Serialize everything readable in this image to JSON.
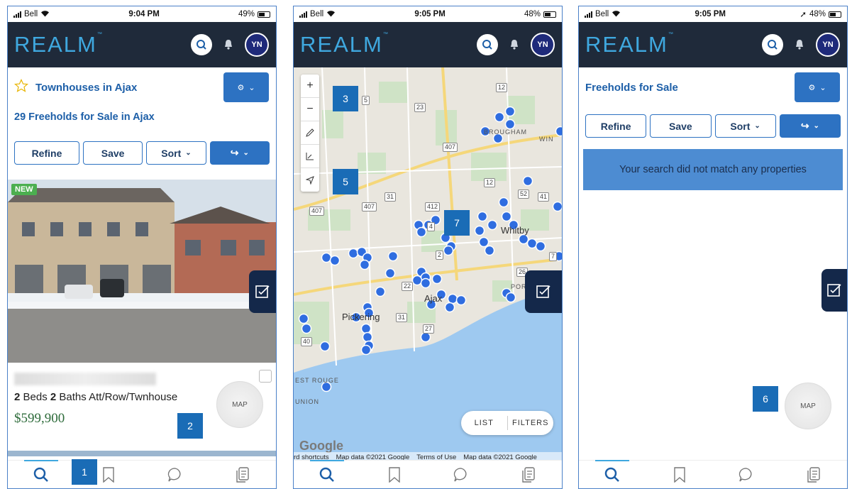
{
  "status": {
    "carrier": "Bell",
    "times": [
      "9:04 PM",
      "9:05 PM",
      "9:05 PM"
    ],
    "battery": [
      "49%",
      "48%",
      "48%"
    ]
  },
  "header": {
    "logo": "REALM",
    "logo_mark": "™",
    "avatar": "YN"
  },
  "screen1": {
    "title": "Townhouses in Ajax",
    "subtitle": "29 Freeholds for Sale in Ajax",
    "buttons": {
      "refine": "Refine",
      "save": "Save",
      "sort": "Sort"
    },
    "listing": {
      "tag": "NEW",
      "beds": "2",
      "beds_label": "Beds",
      "baths": "2",
      "baths_label": "Baths",
      "type": "Att/Row/Twnhouse",
      "price": "$599,900"
    },
    "map_label": "MAP"
  },
  "screen2": {
    "list_label": "LIST",
    "filters_label": "FILTERS",
    "google": "Google",
    "footer": [
      "rd shortcuts",
      "Map data ©2021 Google",
      "Terms of Use",
      "Map data ©2021 Google"
    ],
    "place_labels": [
      "Pickering",
      "Ajax",
      "Whitby",
      "BROUGHAM",
      "PORT",
      "WIN",
      "EST ROUGE",
      "UNION"
    ],
    "road_numbers": [
      "5",
      "23",
      "12",
      "407",
      "407",
      "407",
      "31",
      "412",
      "4",
      "12",
      "52",
      "41",
      "2",
      "22",
      "31",
      "27",
      "40",
      "26",
      "7"
    ]
  },
  "screen3": {
    "title": "Freeholds for Sale",
    "buttons": {
      "refine": "Refine",
      "save": "Save",
      "sort": "Sort"
    },
    "message": "Your search did not match any properties",
    "map_label": "MAP"
  },
  "callouts": [
    "1",
    "2",
    "3",
    "5",
    "7",
    "6"
  ]
}
